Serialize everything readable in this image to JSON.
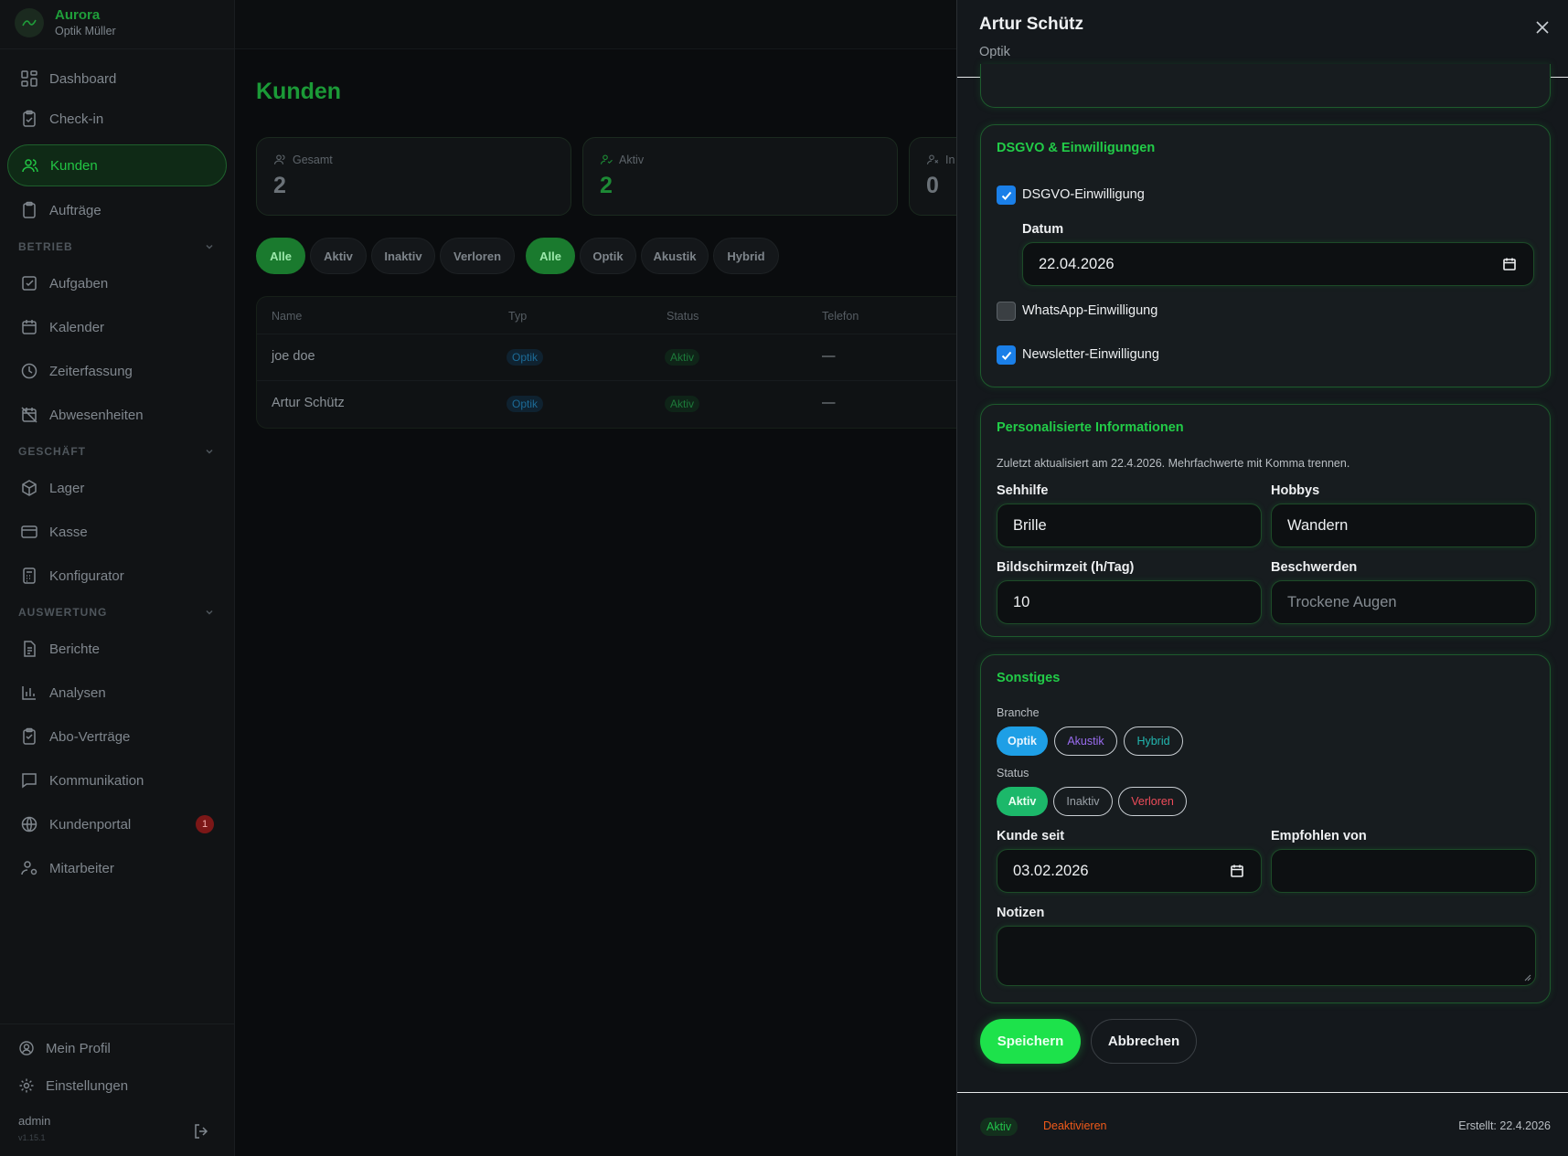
{
  "brand": {
    "name": "Aurora",
    "subtitle": "Optik Müller"
  },
  "nav": {
    "items": [
      {
        "label": "Dashboard",
        "icon": "grid-icon"
      },
      {
        "label": "Check-in",
        "icon": "clipboard-check-icon"
      },
      {
        "label": "Kunden",
        "icon": "users-icon",
        "active": true
      },
      {
        "label": "Aufträge",
        "icon": "clipboard-icon"
      }
    ],
    "sections": [
      {
        "label": "BETRIEB",
        "items": [
          {
            "label": "Aufgaben",
            "icon": "checkbox-square-icon"
          },
          {
            "label": "Kalender",
            "icon": "calendar-icon"
          },
          {
            "label": "Zeiterfassung",
            "icon": "clock-icon"
          },
          {
            "label": "Abwesenheiten",
            "icon": "calendar-off-icon"
          }
        ]
      },
      {
        "label": "GESCHÄFT",
        "items": [
          {
            "label": "Lager",
            "icon": "package-icon"
          },
          {
            "label": "Kasse",
            "icon": "credit-card-icon"
          },
          {
            "label": "Konfigurator",
            "icon": "calculator-icon"
          }
        ]
      },
      {
        "label": "AUSWERTUNG",
        "items": [
          {
            "label": "Berichte",
            "icon": "file-text-icon"
          },
          {
            "label": "Analysen",
            "icon": "bar-chart-icon"
          },
          {
            "label": "Abo-Verträge",
            "icon": "clipboard-list-icon"
          },
          {
            "label": "Kommunikation",
            "icon": "message-square-icon"
          },
          {
            "label": "Kundenportal",
            "icon": "globe-icon",
            "badge": "1"
          },
          {
            "label": "Mitarbeiter",
            "icon": "user-cog-icon"
          }
        ]
      }
    ],
    "footer": {
      "profile": "Mein Profil",
      "settings": "Einstellungen",
      "user": "admin",
      "version": "v1.15.1"
    }
  },
  "main": {
    "title": "Kunden",
    "stats": [
      {
        "label": "Gesamt",
        "value": "2"
      },
      {
        "label": "Aktiv",
        "value": "2"
      },
      {
        "label": "In",
        "value": "0"
      }
    ],
    "status_filters": [
      "Alle",
      "Aktiv",
      "Inaktiv",
      "Verloren"
    ],
    "type_filters": [
      "Alle",
      "Optik",
      "Akustik",
      "Hybrid"
    ],
    "table": {
      "headers": [
        "Name",
        "Typ",
        "Status",
        "Telefon"
      ],
      "rows": [
        {
          "name": "joe doe",
          "typ": "Optik",
          "status": "Aktiv",
          "telefon": "—"
        },
        {
          "name": "Artur Schütz",
          "typ": "Optik",
          "status": "Aktiv",
          "telefon": "—"
        }
      ]
    }
  },
  "panel": {
    "title": "Artur Schütz",
    "subtitle": "Optik",
    "dsgvo": {
      "title": "DSGVO & Einwilligungen",
      "consent_label": "DSGVO-Einwilligung",
      "date_label": "Datum",
      "date_value": "22.04.2026",
      "whatsapp_label": "WhatsApp-Einwilligung",
      "newsletter_label": "Newsletter-Einwilligung"
    },
    "personal": {
      "title": "Personalisierte Informationen",
      "hint": "Zuletzt aktualisiert am 22.4.2026. Mehrfachwerte mit Komma trennen.",
      "sehhilfe_label": "Sehhilfe",
      "sehhilfe_value": "Brille",
      "hobbys_label": "Hobbys",
      "hobbys_value": "Wandern",
      "screen_label": "Bildschirmzeit (h/Tag)",
      "screen_value": "10",
      "complaints_label": "Beschwerden",
      "complaints_placeholder": "Trockene Augen"
    },
    "other": {
      "title": "Sonstiges",
      "branche_label": "Branche",
      "branche_options": [
        "Optik",
        "Akustik",
        "Hybrid"
      ],
      "status_label": "Status",
      "status_options": [
        "Aktiv",
        "Inaktiv",
        "Verloren"
      ],
      "since_label": "Kunde seit",
      "since_value": "03.02.2026",
      "referred_label": "Empfohlen von",
      "notes_label": "Notizen"
    },
    "save": "Speichern",
    "cancel": "Abbrechen",
    "footer": {
      "status": "Aktiv",
      "deactivate": "Deaktivieren",
      "created": "Erstellt: 22.4.2026"
    }
  }
}
